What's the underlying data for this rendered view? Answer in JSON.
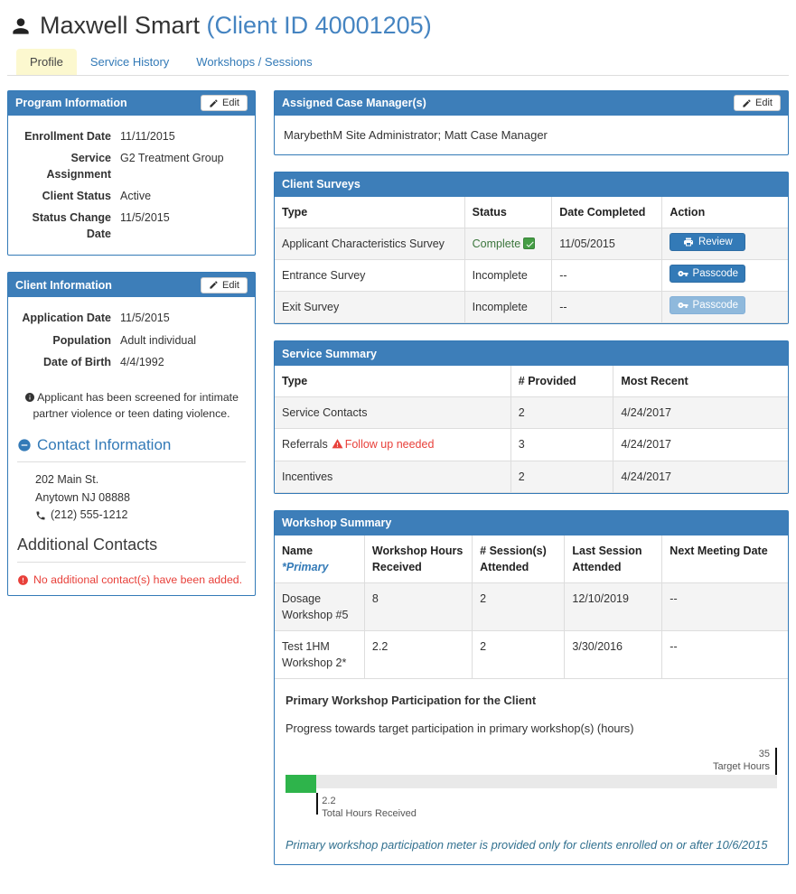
{
  "header": {
    "name": "Maxwell Smart",
    "client_id": "(Client ID 40001205)"
  },
  "tabs": [
    {
      "label": "Profile",
      "active": true
    },
    {
      "label": "Service History",
      "active": false
    },
    {
      "label": "Workshops / Sessions",
      "active": false
    }
  ],
  "edit_label": "Edit",
  "program_information": {
    "title": "Program Information",
    "fields": [
      {
        "label": "Enrollment Date",
        "value": "11/11/2015"
      },
      {
        "label": "Service Assignment",
        "value": "G2 Treatment Group"
      },
      {
        "label": "Client Status",
        "value": "Active"
      },
      {
        "label": "Status Change Date",
        "value": "11/5/2015"
      }
    ]
  },
  "client_information": {
    "title": "Client Information",
    "fields": [
      {
        "label": "Application Date",
        "value": "11/5/2015"
      },
      {
        "label": "Population",
        "value": "Adult individual"
      },
      {
        "label": "Date of Birth",
        "value": "4/4/1992"
      }
    ],
    "screening_note": "Applicant has been screened for intimate partner violence or teen dating violence.",
    "contact_section_title": "Contact Information",
    "address_line1": "202 Main St.",
    "address_line2": "Anytown NJ 08888",
    "phone": "(212) 555-1212",
    "additional_contacts_title": "Additional Contacts",
    "no_contacts_message": "No additional contact(s) have been added."
  },
  "case_managers": {
    "title": "Assigned Case Manager(s)",
    "value": "MarybethM Site Administrator; Matt Case Manager"
  },
  "client_surveys": {
    "title": "Client Surveys",
    "headers": [
      "Type",
      "Status",
      "Date Completed",
      "Action"
    ],
    "rows": [
      {
        "type": "Applicant Characteristics Survey",
        "status": "Complete",
        "date": "11/05/2015",
        "action": "Review"
      },
      {
        "type": "Entrance Survey",
        "status": "Incomplete",
        "date": "--",
        "action": "Passcode"
      },
      {
        "type": "Exit Survey",
        "status": "Incomplete",
        "date": "--",
        "action": "Passcode"
      }
    ]
  },
  "service_summary": {
    "title": "Service Summary",
    "headers": [
      "Type",
      "# Provided",
      "Most Recent"
    ],
    "rows": [
      {
        "type": "Service Contacts",
        "flag": "",
        "provided": "2",
        "recent": "4/24/2017"
      },
      {
        "type": "Referrals",
        "flag": "Follow up needed",
        "provided": "3",
        "recent": "4/24/2017"
      },
      {
        "type": "Incentives",
        "flag": "",
        "provided": "2",
        "recent": "4/24/2017"
      }
    ]
  },
  "workshop_summary": {
    "title": "Workshop Summary",
    "headers": {
      "name": "Name",
      "primary_note": "*Primary",
      "hours": "Workshop Hours Received",
      "sessions": "# Session(s) Attended",
      "last": "Last Session Attended",
      "next": "Next Meeting Date"
    },
    "rows": [
      {
        "name": "Dosage Workshop #5",
        "hours": "8",
        "sessions": "2",
        "last": "12/10/2019",
        "next": "--"
      },
      {
        "name": "Test 1HM Workshop 2*",
        "hours": "2.2",
        "sessions": "2",
        "last": "3/30/2016",
        "next": "--"
      }
    ],
    "meter": {
      "heading": "Primary Workshop Participation for the Client",
      "subheading": "Progress towards target participation in primary workshop(s) (hours)",
      "target_value": "35",
      "target_label": "Target Hours",
      "received_value": "2.2",
      "received_label": "Total Hours Received",
      "percent": 6.3,
      "note": "Primary workshop participation meter is provided only for clients enrolled on or after 10/6/2015"
    }
  },
  "colors": {
    "panel_header_blue": "#3d7eb9",
    "panel_border_blue": "#337ab7",
    "link_blue": "#337ab7",
    "active_tab_yellow": "#fcf8cf",
    "success_green": "#3c763d",
    "check_badge_green": "#449d44",
    "danger_red": "#e8403a",
    "meter_green": "#2eb44b",
    "meter_track_gray": "#e9e9e9",
    "note_blue": "#31708f"
  }
}
